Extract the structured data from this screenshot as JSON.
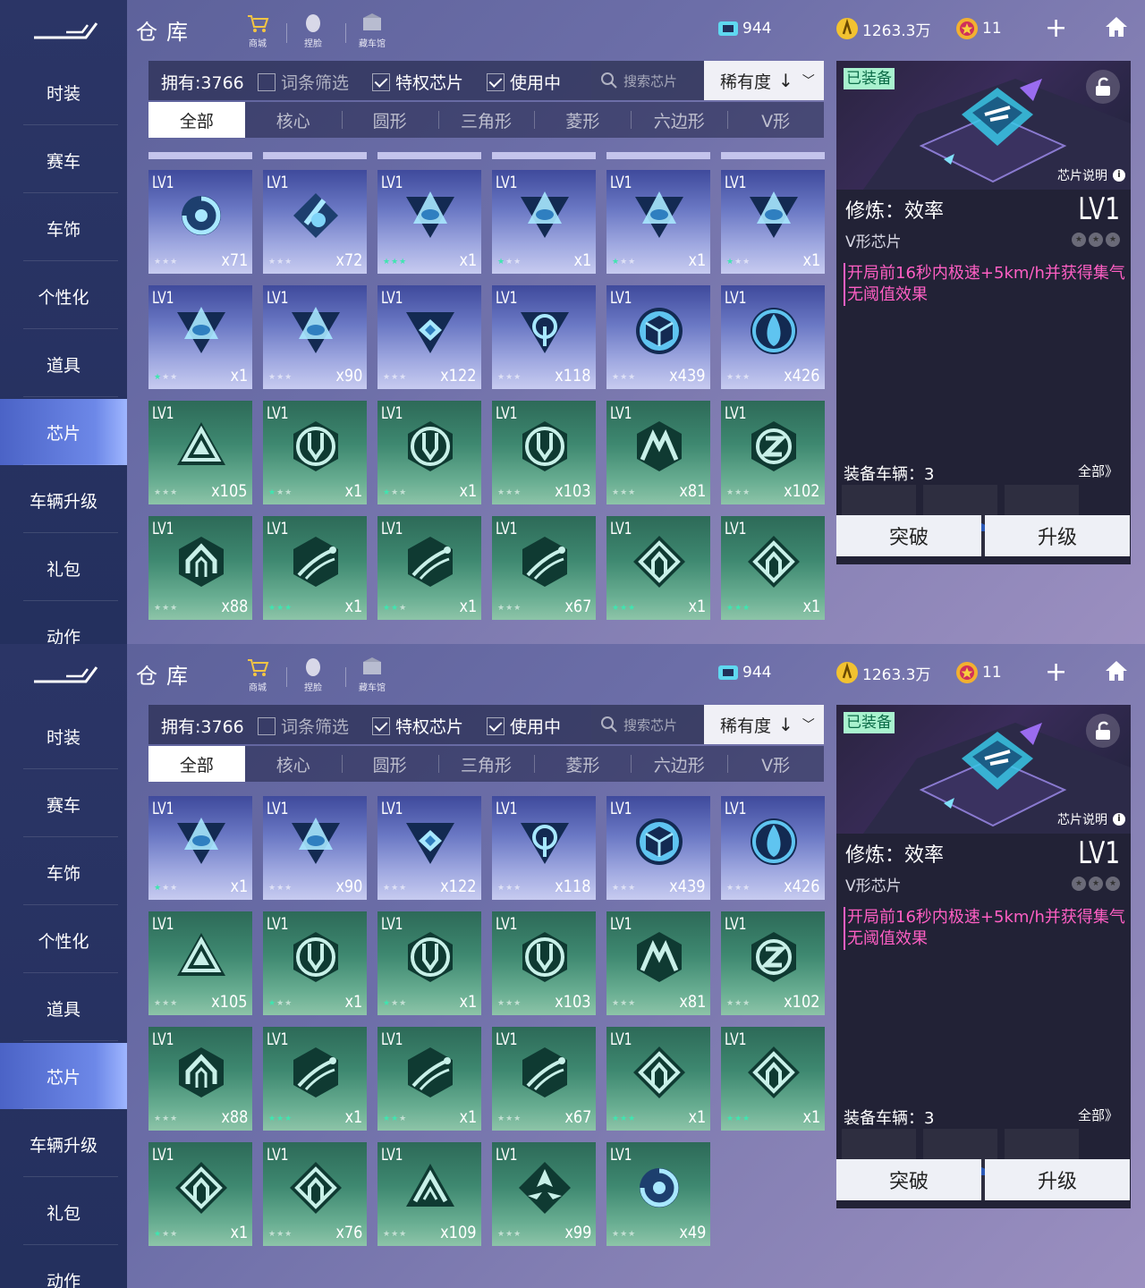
{
  "nav": [
    "时装",
    "赛车",
    "车饰",
    "个性化",
    "道具",
    "芯片",
    "车辆升级",
    "礼包",
    "动作"
  ],
  "active_nav": "芯片",
  "title": "仓库",
  "toolbar": {
    "shop": "商城",
    "face": "捏脸",
    "garage": "藏车馆"
  },
  "currencies": {
    "coupon": "944",
    "coins": "1263.3万",
    "stars": "11"
  },
  "filter": {
    "owned": "拥有:3766",
    "term_filter": "词条筛选",
    "privilege": "特权芯片",
    "in_use": "使用中",
    "search_placeholder": "搜索芯片",
    "sort": "稀有度"
  },
  "tabs": [
    "全部",
    "核心",
    "圆形",
    "三角形",
    "菱形",
    "六边形",
    "V形"
  ],
  "lv_label": "LV1",
  "detail": {
    "equipped_badge": "已装备",
    "chip_info": "芯片说明",
    "name": "修炼：效率",
    "type": "V形芯片",
    "level": "LV1",
    "description": "开局前16秒内极速+5km/h并获得集气无阈值效果",
    "vehicles_label": "装备车辆：3",
    "vehicles_all": "全部》",
    "break_btn": "突破",
    "upgrade_btn": "升级"
  },
  "panels": [
    {
      "partial_top_row": true,
      "chips": [
        {
          "color": "blue",
          "icon": "swirl-chip",
          "stars": 0,
          "qty": "x71"
        },
        {
          "color": "blue",
          "icon": "comet-chip",
          "stars": 0,
          "qty": "x72"
        },
        {
          "color": "blue",
          "icon": "triangle-capsule-chip",
          "stars": 3,
          "qty": "x1"
        },
        {
          "color": "blue",
          "icon": "triangle-capsule-chip",
          "stars": 1,
          "qty": "x1"
        },
        {
          "color": "blue",
          "icon": "triangle-capsule-chip",
          "stars": 1,
          "qty": "x1"
        },
        {
          "color": "blue",
          "icon": "triangle-capsule-chip",
          "stars": 1,
          "qty": "x1"
        },
        {
          "color": "blue",
          "icon": "triangle-capsule-chip",
          "stars": 1,
          "qty": "x1"
        },
        {
          "color": "blue",
          "icon": "triangle-capsule-chip",
          "stars": 0,
          "qty": "x90"
        },
        {
          "color": "blue",
          "icon": "v-diamond-chip",
          "stars": 0,
          "qty": "x122"
        },
        {
          "color": "blue",
          "icon": "arch-beam-chip",
          "stars": 0,
          "qty": "x118"
        },
        {
          "color": "blue",
          "icon": "cube-circle-chip",
          "stars": 0,
          "qty": "x439"
        },
        {
          "color": "blue",
          "icon": "drop-circle-chip",
          "stars": 0,
          "qty": "x426"
        },
        {
          "color": "green",
          "icon": "triforce-chip",
          "stars": 0,
          "qty": "x105"
        },
        {
          "color": "green",
          "icon": "hex-down-chip",
          "stars": 1,
          "qty": "x1"
        },
        {
          "color": "green",
          "icon": "hex-down-chip",
          "stars": 1,
          "qty": "x1"
        },
        {
          "color": "green",
          "icon": "hex-down-chip",
          "stars": 0,
          "qty": "x103"
        },
        {
          "color": "green",
          "icon": "m-mountain-chip",
          "stars": 0,
          "qty": "x81"
        },
        {
          "color": "green",
          "icon": "z-gear-chip",
          "stars": 0,
          "qty": "x102"
        },
        {
          "color": "green",
          "icon": "hex-arch-chip",
          "stars": 0,
          "qty": "x88"
        },
        {
          "color": "green",
          "icon": "hex-streak-chip",
          "stars": 3,
          "qty": "x1"
        },
        {
          "color": "green",
          "icon": "hex-streak-chip",
          "stars": 2,
          "qty": "x1"
        },
        {
          "color": "green",
          "icon": "hex-streak-chip",
          "stars": 0,
          "qty": "x67"
        },
        {
          "color": "green",
          "icon": "diamond-arch-chip",
          "stars": 3,
          "qty": "x1"
        },
        {
          "color": "green",
          "icon": "diamond-arch-chip",
          "stars": 3,
          "qty": "x1"
        }
      ]
    },
    {
      "partial_top_row": false,
      "chips": [
        {
          "color": "blue",
          "icon": "triangle-capsule-chip",
          "stars": 1,
          "qty": "x1"
        },
        {
          "color": "blue",
          "icon": "triangle-capsule-chip",
          "stars": 0,
          "qty": "x90"
        },
        {
          "color": "blue",
          "icon": "v-diamond-chip",
          "stars": 0,
          "qty": "x122"
        },
        {
          "color": "blue",
          "icon": "arch-beam-chip",
          "stars": 0,
          "qty": "x118"
        },
        {
          "color": "blue",
          "icon": "cube-circle-chip",
          "stars": 0,
          "qty": "x439"
        },
        {
          "color": "blue",
          "icon": "drop-circle-chip",
          "stars": 0,
          "qty": "x426"
        },
        {
          "color": "green",
          "icon": "triforce-chip",
          "stars": 0,
          "qty": "x105"
        },
        {
          "color": "green",
          "icon": "hex-down-chip",
          "stars": 1,
          "qty": "x1"
        },
        {
          "color": "green",
          "icon": "hex-down-chip",
          "stars": 1,
          "qty": "x1"
        },
        {
          "color": "green",
          "icon": "hex-down-chip",
          "stars": 0,
          "qty": "x103"
        },
        {
          "color": "green",
          "icon": "m-mountain-chip",
          "stars": 0,
          "qty": "x81"
        },
        {
          "color": "green",
          "icon": "z-gear-chip",
          "stars": 0,
          "qty": "x102"
        },
        {
          "color": "green",
          "icon": "hex-arch-chip",
          "stars": 0,
          "qty": "x88"
        },
        {
          "color": "green",
          "icon": "hex-streak-chip",
          "stars": 3,
          "qty": "x1"
        },
        {
          "color": "green",
          "icon": "hex-streak-chip",
          "stars": 2,
          "qty": "x1"
        },
        {
          "color": "green",
          "icon": "hex-streak-chip",
          "stars": 0,
          "qty": "x67"
        },
        {
          "color": "green",
          "icon": "diamond-arch-chip",
          "stars": 3,
          "qty": "x1"
        },
        {
          "color": "green",
          "icon": "diamond-arch-chip",
          "stars": 3,
          "qty": "x1"
        },
        {
          "color": "green",
          "icon": "diamond-arch-chip",
          "stars": 1,
          "qty": "x1"
        },
        {
          "color": "green",
          "icon": "diamond-arch-chip",
          "stars": 0,
          "qty": "x76"
        },
        {
          "color": "green",
          "icon": "triangle-arrow-chip",
          "stars": 0,
          "qty": "x109"
        },
        {
          "color": "green",
          "icon": "trefoil-chip",
          "stars": 0,
          "qty": "x99"
        },
        {
          "color": "green",
          "icon": "swirl-chip",
          "stars": 0,
          "qty": "x49"
        }
      ]
    }
  ]
}
